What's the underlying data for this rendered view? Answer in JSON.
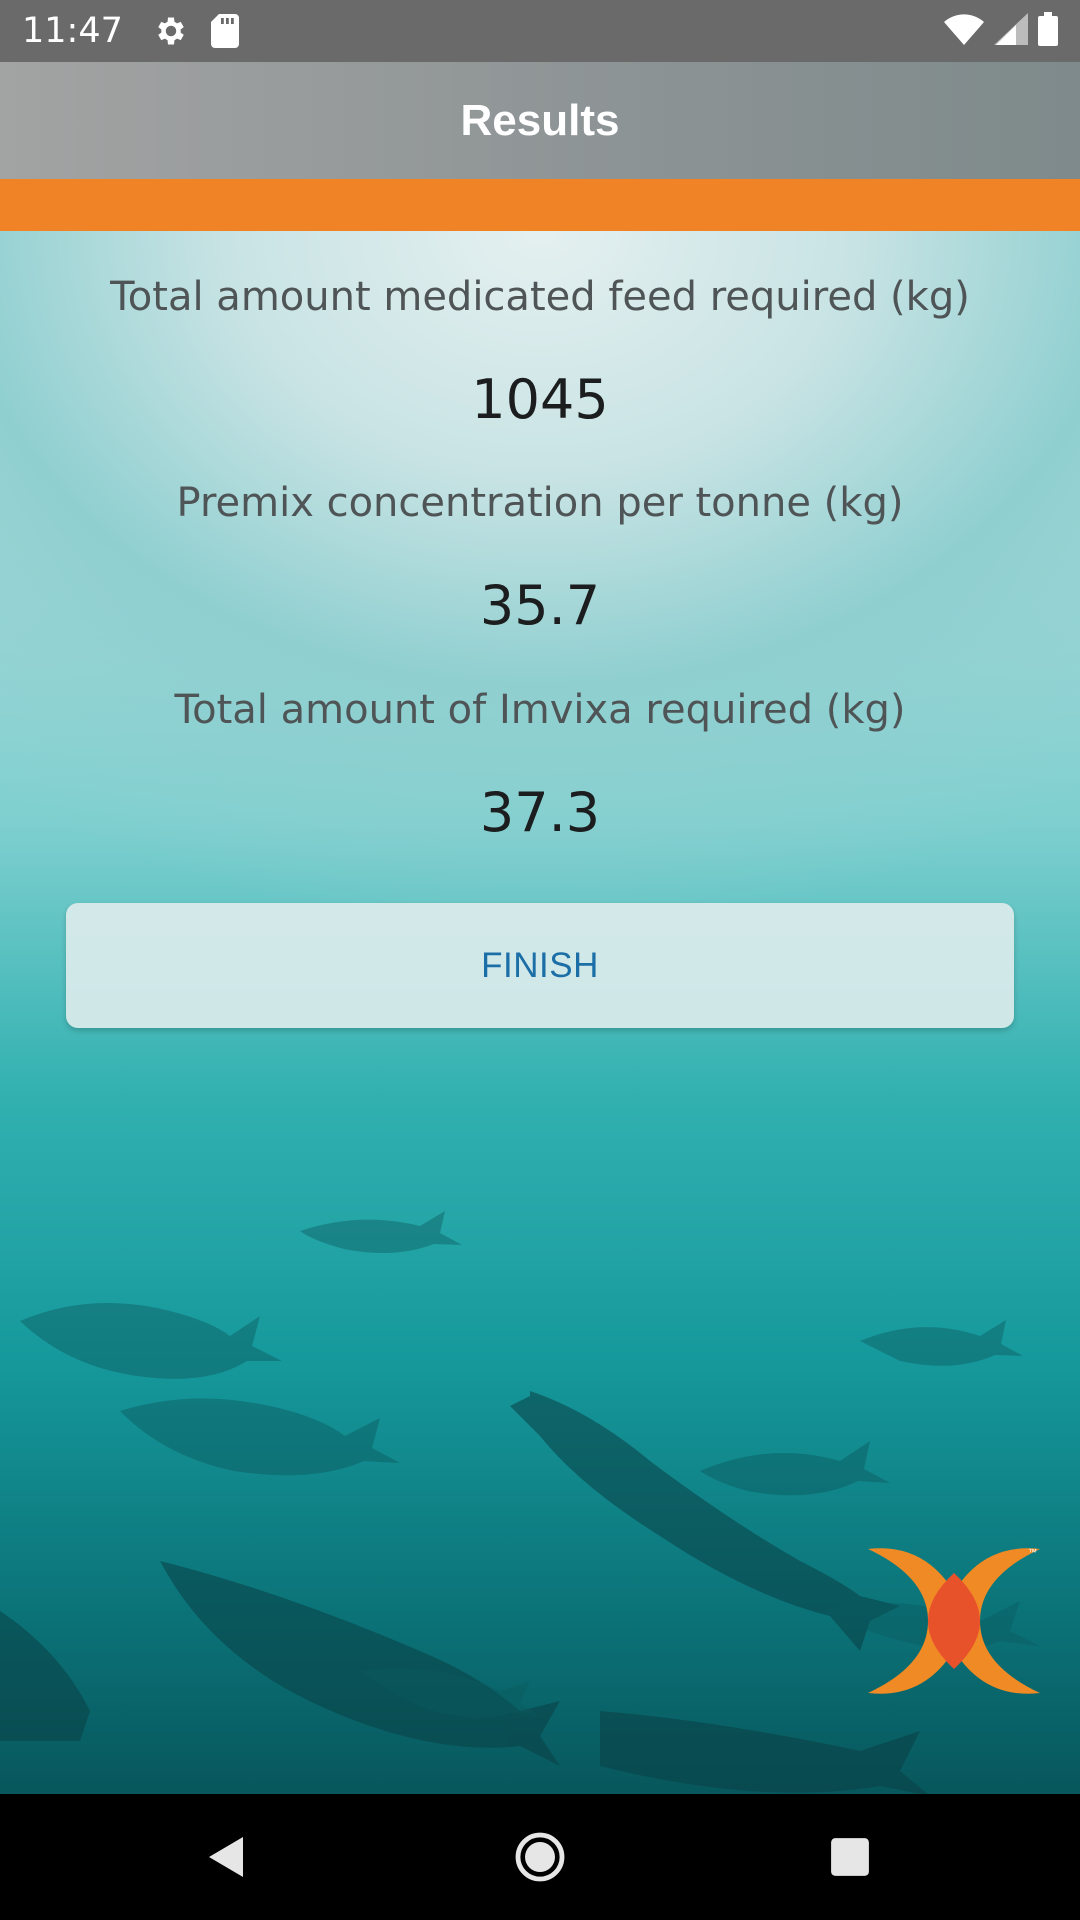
{
  "status_bar": {
    "time": "11:47",
    "left_icons": [
      "gear-icon",
      "sd-card-icon"
    ],
    "right_icons": [
      "wifi-icon",
      "signal-icon",
      "battery-icon"
    ]
  },
  "app_bar": {
    "title": "Results"
  },
  "colors": {
    "accent": "#ef8326",
    "button_text": "#1b6fa6",
    "app_bar": "#8c9394"
  },
  "results": [
    {
      "label": "Total amount medicated feed required (kg)",
      "value": "1045"
    },
    {
      "label": "Premix concentration per tonne (kg)",
      "value": "35.7"
    },
    {
      "label": "Total amount of Imvixa required (kg)",
      "value": "37.3"
    }
  ],
  "finish_label": "FINISH",
  "brand": {
    "logo": "imvixa-logo-icon",
    "tm": "™"
  },
  "nav_bar": {
    "buttons": [
      "back-icon",
      "home-icon",
      "recents-icon"
    ]
  }
}
